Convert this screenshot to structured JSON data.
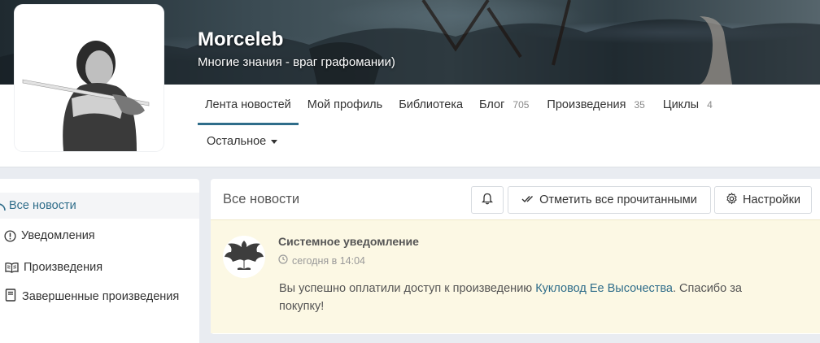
{
  "profile": {
    "name": "Morceleb",
    "tagline": "Многие знания - враг графомании)"
  },
  "tabs": [
    {
      "label": "Лента новостей",
      "count": "",
      "active": true
    },
    {
      "label": "Мой профиль",
      "count": ""
    },
    {
      "label": "Библиотека",
      "count": ""
    },
    {
      "label": "Блог",
      "count": "705"
    },
    {
      "label": "Произведения",
      "count": "35"
    },
    {
      "label": "Циклы",
      "count": "4"
    }
  ],
  "more_menu": {
    "label": "Остальное",
    "icon": "caret-down-icon"
  },
  "sidebar": {
    "items": [
      {
        "label": "Все новости",
        "icon": "rss-icon",
        "active": true
      },
      {
        "label": "Уведомления",
        "icon": "exclamation-circle-icon"
      },
      {
        "label": "Произведения",
        "icon": "book-open-icon"
      },
      {
        "label": "Завершенные произведения",
        "icon": "book-icon"
      }
    ]
  },
  "main": {
    "title": "Все новости",
    "bell_icon": "bell-icon",
    "mark_all_read_label": "Отметить все прочитанными",
    "settings_label": "Настройки"
  },
  "notification": {
    "title": "Системное уведомление",
    "time": "сегодня в 14:04",
    "text_before": "Вы успешно оплатили доступ к произведению ",
    "link_text": "Кукловод Ее Высочества",
    "text_after": ". Спасибо за покупку!"
  },
  "colors": {
    "accent": "#2f6d8a",
    "notification_bg": "#fcf8e4",
    "page_bg": "#e9ecf1"
  }
}
